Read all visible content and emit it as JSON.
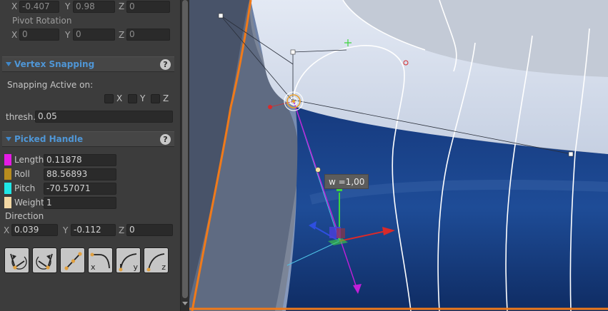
{
  "inspector": {
    "pivot_position": {
      "x_axis": "X",
      "x": "-0.407",
      "y_axis": "Y",
      "y": "0.98",
      "z_axis": "Z",
      "z": "0"
    },
    "pivot_rotation": {
      "label": "Pivot Rotation",
      "x_axis": "X",
      "x": "0",
      "y_axis": "Y",
      "y": "0",
      "z_axis": "Z",
      "z": "0"
    },
    "vertex_snapping": {
      "title": "Vertex Snapping",
      "help": "?",
      "active_label": "Snapping Active on:",
      "x_label": "X",
      "x_checked": false,
      "y_label": "Y",
      "y_checked": false,
      "z_label": "Z",
      "z_checked": false,
      "thresh_label": "thresh.",
      "thresh_value": "0.05"
    },
    "picked_handle": {
      "title": "Picked Handle",
      "help": "?",
      "properties": [
        {
          "label": "Length",
          "value": "0.11878",
          "color": "#e41be4"
        },
        {
          "label": "Roll",
          "value": "88.56893",
          "color": "#b78c1e"
        },
        {
          "label": "Pitch",
          "value": "-70.57071",
          "color": "#1fe6e6"
        },
        {
          "label": "Weight",
          "value": "1",
          "color": "#f2d7a4"
        }
      ],
      "direction_label": "Direction",
      "direction": {
        "x_axis": "X",
        "x": "0.039",
        "y_axis": "Y",
        "y": "-0.112",
        "z_axis": "Z",
        "z": "0"
      }
    },
    "tools": [
      {
        "name": "rotate-left-icon",
        "sub": ""
      },
      {
        "name": "rotate-right-icon",
        "sub": ""
      },
      {
        "name": "align-handles-icon",
        "sub": ""
      },
      {
        "name": "curve-x-icon",
        "sub": "x"
      },
      {
        "name": "curve-y-icon",
        "sub": "y"
      },
      {
        "name": "curve-z-icon",
        "sub": "z"
      }
    ]
  },
  "viewport": {
    "weight_label": "w =1,00",
    "colors": {
      "selection_outline": "#f07a1a",
      "gizmo_x": "#d82a2a",
      "gizmo_y": "#3ed43e",
      "gizmo_z": "#2e4fe0",
      "handle_tangent": "#c21fd8"
    }
  }
}
